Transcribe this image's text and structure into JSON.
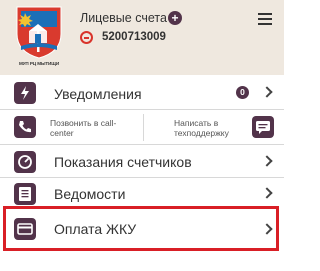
{
  "header": {
    "crest_caption": "МУП РЦ МЫТИЩИ",
    "accounts_title": "Лицевые счета",
    "add_symbol": "+",
    "account_number": "5200713009"
  },
  "menu": {
    "notifications": {
      "label": "Уведомления",
      "badge": "0"
    },
    "call_center": {
      "label": "Позвонить в call-center"
    },
    "support": {
      "label": "Написать в техподдержку"
    },
    "meters": {
      "label": "Показания счетчиков"
    },
    "statements": {
      "label": "Ведомости"
    },
    "payment": {
      "label": "Оплата ЖКУ"
    }
  },
  "colors": {
    "accent": "#52334a",
    "header_bg": "#efe8df",
    "highlight": "#d91f26",
    "remove": "#d9342b"
  }
}
